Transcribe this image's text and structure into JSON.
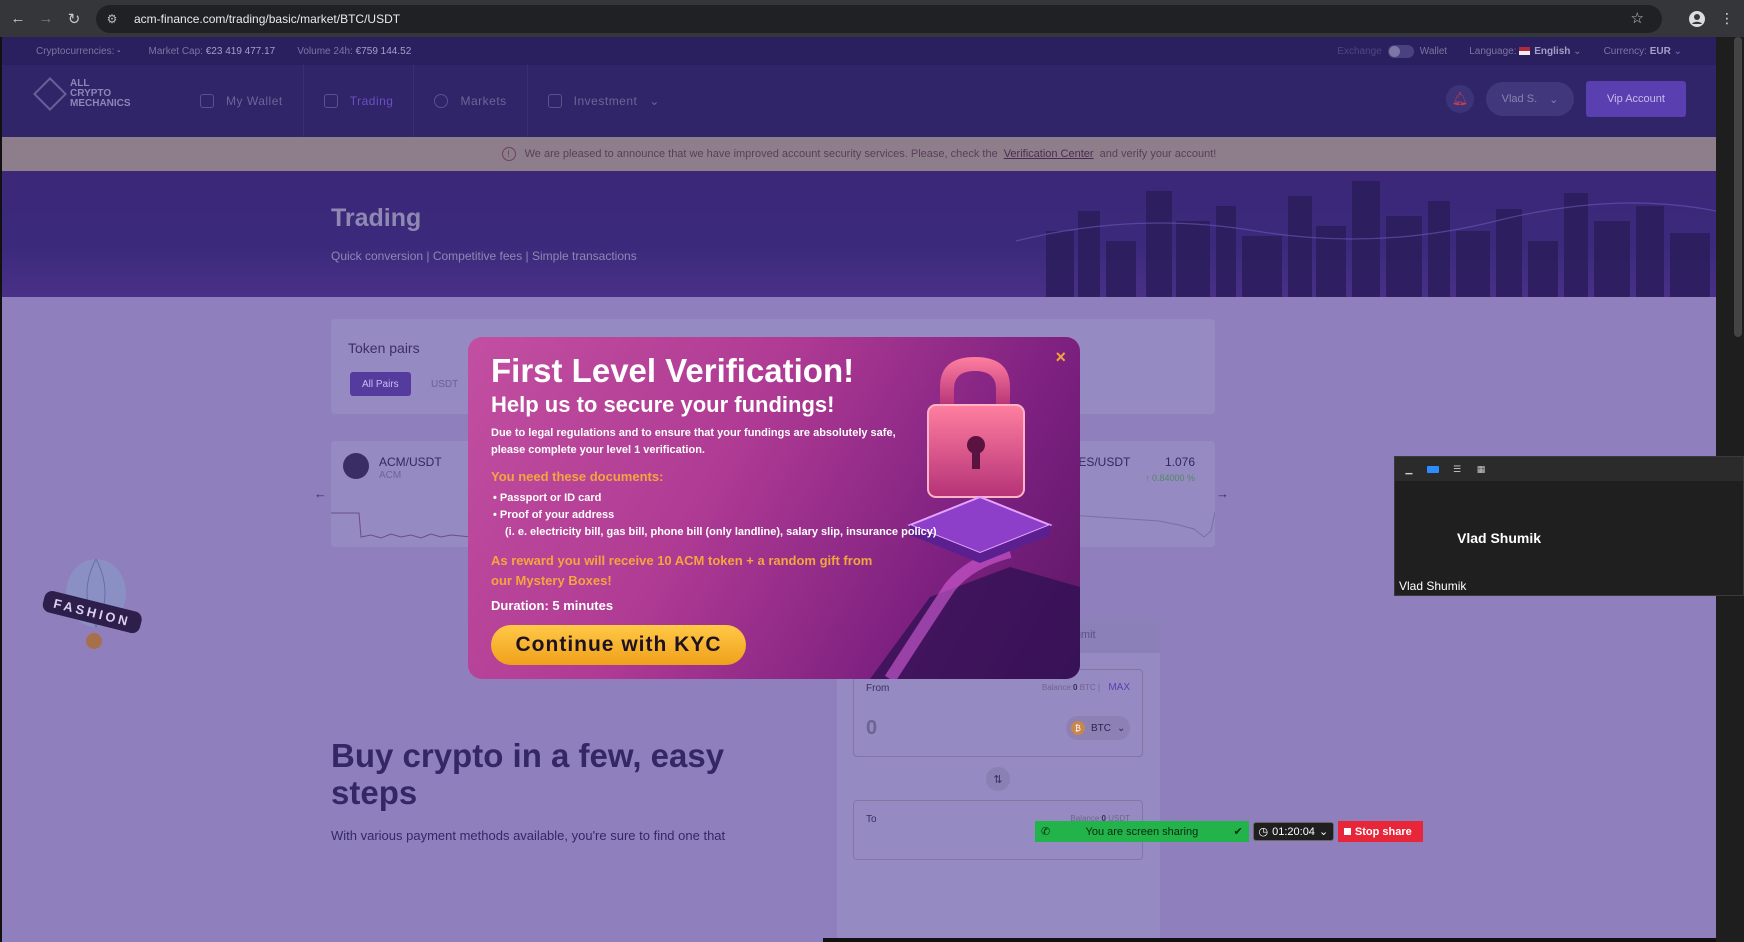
{
  "browser": {
    "url": "acm-finance.com/trading/basic/market/BTC/USDT"
  },
  "topinfo": {
    "cryptocurrencies_label": "Cryptocurrencies:",
    "cryptocurrencies_value": "-",
    "marketcap_label": "Market Cap:",
    "marketcap_value": "€23 419 477.17",
    "volume_label": "Volume 24h:",
    "volume_value": "€759 144.52",
    "exchange_label": "Exchange",
    "wallet_label": "Wallet",
    "language_label": "Language:",
    "language_value": "English",
    "currency_label": "Currency:",
    "currency_value": "EUR"
  },
  "header": {
    "logo_line1": "ALL",
    "logo_line2": "CRYPTO",
    "logo_line3": "MECHANICS",
    "menu": [
      "My Wallet",
      "Trading",
      "Markets",
      "Investment"
    ],
    "user": "Vlad S.",
    "vip": "Vip Account"
  },
  "notice": {
    "text_before": "We are pleased to announce that we have improved account security services. Please, check the",
    "link": "Verification Center",
    "text_after": "and verify your account!"
  },
  "hero": {
    "title": "Trading",
    "subtitle": "Quick conversion | Competitive fees | Simple transactions"
  },
  "token_pairs": {
    "title": "Token pairs",
    "filters": [
      "All Pairs",
      "USDT"
    ]
  },
  "tickers": [
    {
      "pair": "ACM/USDT",
      "sub": "ACM"
    },
    {
      "pair": "/ES/USDT",
      "price": "1.076",
      "change": "↑ 0.84000 %"
    }
  ],
  "trade": {
    "limit_tab": "Limit",
    "from_label": "From",
    "balance_label": "Balance:",
    "balance_value": "0",
    "balance_unit": "BTC",
    "max": "MAX",
    "amount": "0",
    "from_coin": "BTC",
    "to_label": "To",
    "to_balance_value": "0",
    "to_balance_unit": "USDT"
  },
  "buy_section": {
    "title": "Buy crypto in a few, easy steps",
    "text": "With various payment methods available, you're sure to find one that"
  },
  "modal": {
    "title": "First Level Verification!",
    "subtitle": "Help us to secure your fundings!",
    "description": "Due to legal regulations and to ensure that your fundings are absolutely safe, please complete your level 1 verification.",
    "documents_heading": "You need these documents:",
    "documents": [
      "Passport or ID card",
      "Proof of your address"
    ],
    "documents_note": "(i. e. electricity bill, gas bill, phone bill (only landline), salary slip, insurance policy)",
    "reward": "As reward you will receive 10 ACM token + a random gift from our Mystery Boxes!",
    "duration": "Duration: 5 minutes",
    "button": "Continue with KYC",
    "close": "×"
  },
  "balloon_text": "FASHION",
  "video_panel": {
    "name": "Vlad Shumik",
    "label": "Vlad Shumik"
  },
  "share_bar": {
    "status": "You are screen sharing",
    "timer": "01:20:04",
    "stop": "Stop share"
  },
  "colors": {
    "site_bg": "#8f80bd",
    "header_bg": "#2f2568",
    "modal_accent": "#f3a63e",
    "kyc_button": "#f0a11b",
    "share_green": "#23b34b",
    "stop_red": "#e8263a"
  }
}
